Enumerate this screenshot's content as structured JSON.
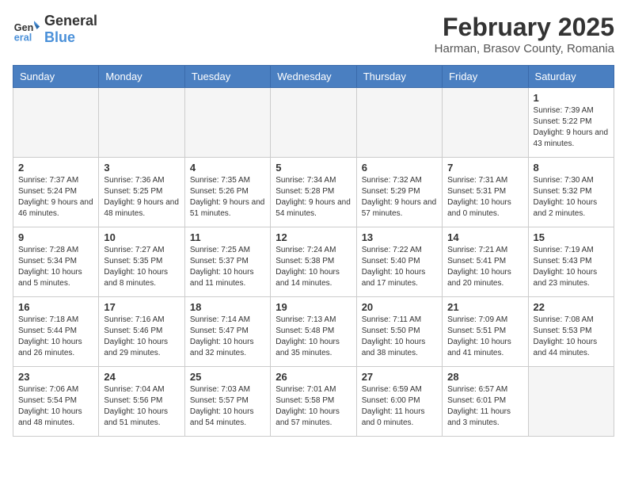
{
  "header": {
    "logo_general": "General",
    "logo_blue": "Blue",
    "month_title": "February 2025",
    "location": "Harman, Brasov County, Romania"
  },
  "days_of_week": [
    "Sunday",
    "Monday",
    "Tuesday",
    "Wednesday",
    "Thursday",
    "Friday",
    "Saturday"
  ],
  "weeks": [
    [
      {
        "day": "",
        "info": ""
      },
      {
        "day": "",
        "info": ""
      },
      {
        "day": "",
        "info": ""
      },
      {
        "day": "",
        "info": ""
      },
      {
        "day": "",
        "info": ""
      },
      {
        "day": "",
        "info": ""
      },
      {
        "day": "1",
        "info": "Sunrise: 7:39 AM\nSunset: 5:22 PM\nDaylight: 9 hours and 43 minutes."
      }
    ],
    [
      {
        "day": "2",
        "info": "Sunrise: 7:37 AM\nSunset: 5:24 PM\nDaylight: 9 hours and 46 minutes."
      },
      {
        "day": "3",
        "info": "Sunrise: 7:36 AM\nSunset: 5:25 PM\nDaylight: 9 hours and 48 minutes."
      },
      {
        "day": "4",
        "info": "Sunrise: 7:35 AM\nSunset: 5:26 PM\nDaylight: 9 hours and 51 minutes."
      },
      {
        "day": "5",
        "info": "Sunrise: 7:34 AM\nSunset: 5:28 PM\nDaylight: 9 hours and 54 minutes."
      },
      {
        "day": "6",
        "info": "Sunrise: 7:32 AM\nSunset: 5:29 PM\nDaylight: 9 hours and 57 minutes."
      },
      {
        "day": "7",
        "info": "Sunrise: 7:31 AM\nSunset: 5:31 PM\nDaylight: 10 hours and 0 minutes."
      },
      {
        "day": "8",
        "info": "Sunrise: 7:30 AM\nSunset: 5:32 PM\nDaylight: 10 hours and 2 minutes."
      }
    ],
    [
      {
        "day": "9",
        "info": "Sunrise: 7:28 AM\nSunset: 5:34 PM\nDaylight: 10 hours and 5 minutes."
      },
      {
        "day": "10",
        "info": "Sunrise: 7:27 AM\nSunset: 5:35 PM\nDaylight: 10 hours and 8 minutes."
      },
      {
        "day": "11",
        "info": "Sunrise: 7:25 AM\nSunset: 5:37 PM\nDaylight: 10 hours and 11 minutes."
      },
      {
        "day": "12",
        "info": "Sunrise: 7:24 AM\nSunset: 5:38 PM\nDaylight: 10 hours and 14 minutes."
      },
      {
        "day": "13",
        "info": "Sunrise: 7:22 AM\nSunset: 5:40 PM\nDaylight: 10 hours and 17 minutes."
      },
      {
        "day": "14",
        "info": "Sunrise: 7:21 AM\nSunset: 5:41 PM\nDaylight: 10 hours and 20 minutes."
      },
      {
        "day": "15",
        "info": "Sunrise: 7:19 AM\nSunset: 5:43 PM\nDaylight: 10 hours and 23 minutes."
      }
    ],
    [
      {
        "day": "16",
        "info": "Sunrise: 7:18 AM\nSunset: 5:44 PM\nDaylight: 10 hours and 26 minutes."
      },
      {
        "day": "17",
        "info": "Sunrise: 7:16 AM\nSunset: 5:46 PM\nDaylight: 10 hours and 29 minutes."
      },
      {
        "day": "18",
        "info": "Sunrise: 7:14 AM\nSunset: 5:47 PM\nDaylight: 10 hours and 32 minutes."
      },
      {
        "day": "19",
        "info": "Sunrise: 7:13 AM\nSunset: 5:48 PM\nDaylight: 10 hours and 35 minutes."
      },
      {
        "day": "20",
        "info": "Sunrise: 7:11 AM\nSunset: 5:50 PM\nDaylight: 10 hours and 38 minutes."
      },
      {
        "day": "21",
        "info": "Sunrise: 7:09 AM\nSunset: 5:51 PM\nDaylight: 10 hours and 41 minutes."
      },
      {
        "day": "22",
        "info": "Sunrise: 7:08 AM\nSunset: 5:53 PM\nDaylight: 10 hours and 44 minutes."
      }
    ],
    [
      {
        "day": "23",
        "info": "Sunrise: 7:06 AM\nSunset: 5:54 PM\nDaylight: 10 hours and 48 minutes."
      },
      {
        "day": "24",
        "info": "Sunrise: 7:04 AM\nSunset: 5:56 PM\nDaylight: 10 hours and 51 minutes."
      },
      {
        "day": "25",
        "info": "Sunrise: 7:03 AM\nSunset: 5:57 PM\nDaylight: 10 hours and 54 minutes."
      },
      {
        "day": "26",
        "info": "Sunrise: 7:01 AM\nSunset: 5:58 PM\nDaylight: 10 hours and 57 minutes."
      },
      {
        "day": "27",
        "info": "Sunrise: 6:59 AM\nSunset: 6:00 PM\nDaylight: 11 hours and 0 minutes."
      },
      {
        "day": "28",
        "info": "Sunrise: 6:57 AM\nSunset: 6:01 PM\nDaylight: 11 hours and 3 minutes."
      },
      {
        "day": "",
        "info": ""
      }
    ]
  ]
}
